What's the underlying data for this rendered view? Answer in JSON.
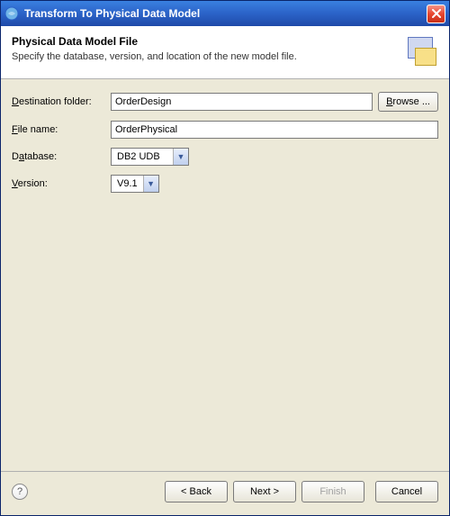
{
  "window": {
    "title": "Transform To Physical Data Model"
  },
  "header": {
    "title": "Physical Data Model File",
    "subtitle": "Specify the database, version, and location of the new model file."
  },
  "form": {
    "destination": {
      "label": "Destination folder:",
      "value": "OrderDesign",
      "browse_label": "Browse ..."
    },
    "filename": {
      "label": "File name:",
      "value": "OrderPhysical"
    },
    "database": {
      "label": "Database:",
      "selected": "DB2 UDB"
    },
    "version": {
      "label": "Version:",
      "selected": "V9.1"
    }
  },
  "footer": {
    "help": "?",
    "back": "< Back",
    "next": "Next >",
    "finish": "Finish",
    "cancel": "Cancel"
  }
}
